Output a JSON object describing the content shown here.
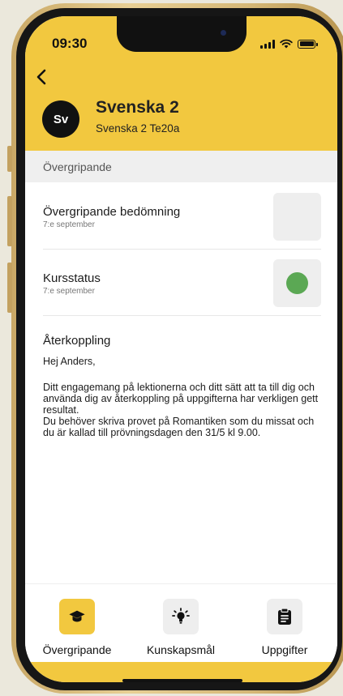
{
  "status_bar": {
    "time": "09:30"
  },
  "header": {
    "avatar_initials": "Sv",
    "title": "Svenska 2",
    "subtitle": "Svenska 2 Te20a"
  },
  "section": {
    "label": "Övergripande"
  },
  "rows": [
    {
      "title": "Övergripande bedömning",
      "date": "7:e september"
    },
    {
      "title": "Kursstatus",
      "date": "7:e september",
      "status_color": "#5ba854"
    }
  ],
  "feedback": {
    "title": "Återkoppling",
    "greeting": "Hej Anders,",
    "body": "Ditt engagemang på lektionerna och ditt sätt att ta till dig och använda dig av återkoppling på uppgifterna har verkligen gett resultat.\nDu behöver skriva provet på Romantiken som du missat och du är kallad till prövningsdagen den 31/5  kl 9.00."
  },
  "tabs": [
    {
      "label": "Övergripande",
      "icon": "graduation-cap-icon",
      "active": true
    },
    {
      "label": "Kunskapsmål",
      "icon": "lightbulb-icon",
      "active": false
    },
    {
      "label": "Uppgifter",
      "icon": "clipboard-icon",
      "active": false
    }
  ],
  "colors": {
    "accent": "#f2c83f",
    "status_green": "#5ba854"
  }
}
